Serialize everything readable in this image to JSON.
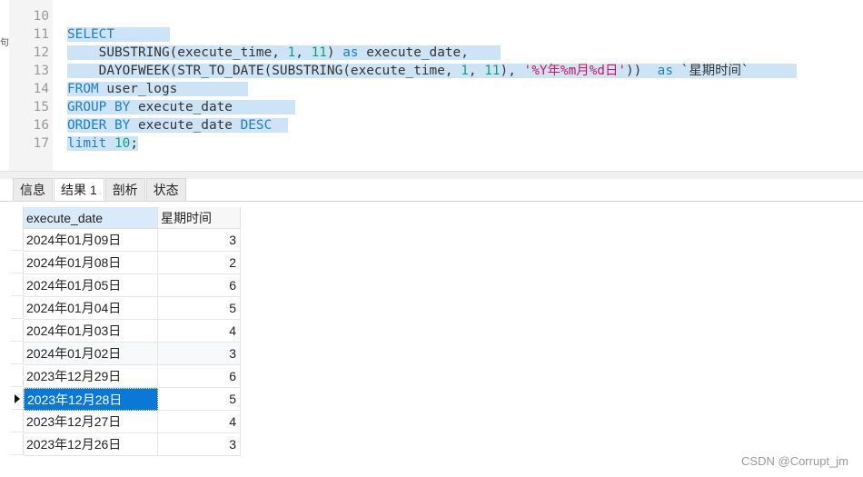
{
  "editor": {
    "edge_glyph": "句",
    "lines": [
      {
        "n": "10"
      },
      {
        "n": "11"
      },
      {
        "n": "12"
      },
      {
        "n": "13"
      },
      {
        "n": "14"
      },
      {
        "n": "15"
      },
      {
        "n": "16"
      },
      {
        "n": "17"
      }
    ],
    "tokens": {
      "select": "SELECT",
      "l12_indent": "    ",
      "l12_fn": "SUBSTRING(execute_time, ",
      "l12_n1": "1",
      "l12_sep": ", ",
      "l12_n2": "11",
      "l12_close": ") ",
      "l12_as": "as",
      "l12_alias": " execute_date,",
      "l13_indent": "    ",
      "l13_fn": "DAYOFWEEK(STR_TO_DATE(SUBSTRING(execute_time, ",
      "l13_n1": "1",
      "l13_sep": ", ",
      "l13_n2": "11",
      "l13_close": "), ",
      "l13_str": "'%Y年%m月%d日'",
      "l13_close2": "))  ",
      "l13_as": "as",
      "l13_alias": " `星期时间`",
      "from": "FROM",
      "from_tbl": " user_logs",
      "group": "GROUP BY",
      "group_col": " execute_date",
      "order": "ORDER BY",
      "order_col": " execute_date ",
      "desc": "DESC",
      "limit": "limit",
      "limit_sp": " ",
      "limit_n": "10",
      "limit_end": ";"
    }
  },
  "tabs": [
    {
      "label": "信息",
      "active": false
    },
    {
      "label": "结果 1",
      "active": true
    },
    {
      "label": "剖析",
      "active": false
    },
    {
      "label": "状态",
      "active": false
    }
  ],
  "grid": {
    "columns": [
      "execute_date",
      "星期时间"
    ],
    "rows": [
      [
        "2024年01月09日",
        "3"
      ],
      [
        "2024年01月08日",
        "2"
      ],
      [
        "2024年01月05日",
        "6"
      ],
      [
        "2024年01月04日",
        "5"
      ],
      [
        "2024年01月03日",
        "4"
      ],
      [
        "2024年01月02日",
        "3"
      ],
      [
        "2023年12月29日",
        "6"
      ],
      [
        "2023年12月28日",
        "5"
      ],
      [
        "2023年12月27日",
        "4"
      ],
      [
        "2023年12月26日",
        "3"
      ]
    ],
    "selected_row": 7
  },
  "watermark": "CSDN @Corrupt_jm",
  "colors": {
    "selection": "#cde4f7",
    "keyword": "#1f7fc4",
    "number": "#09a37a",
    "string": "#d4145a",
    "selected_cell": "#0a78d7"
  }
}
